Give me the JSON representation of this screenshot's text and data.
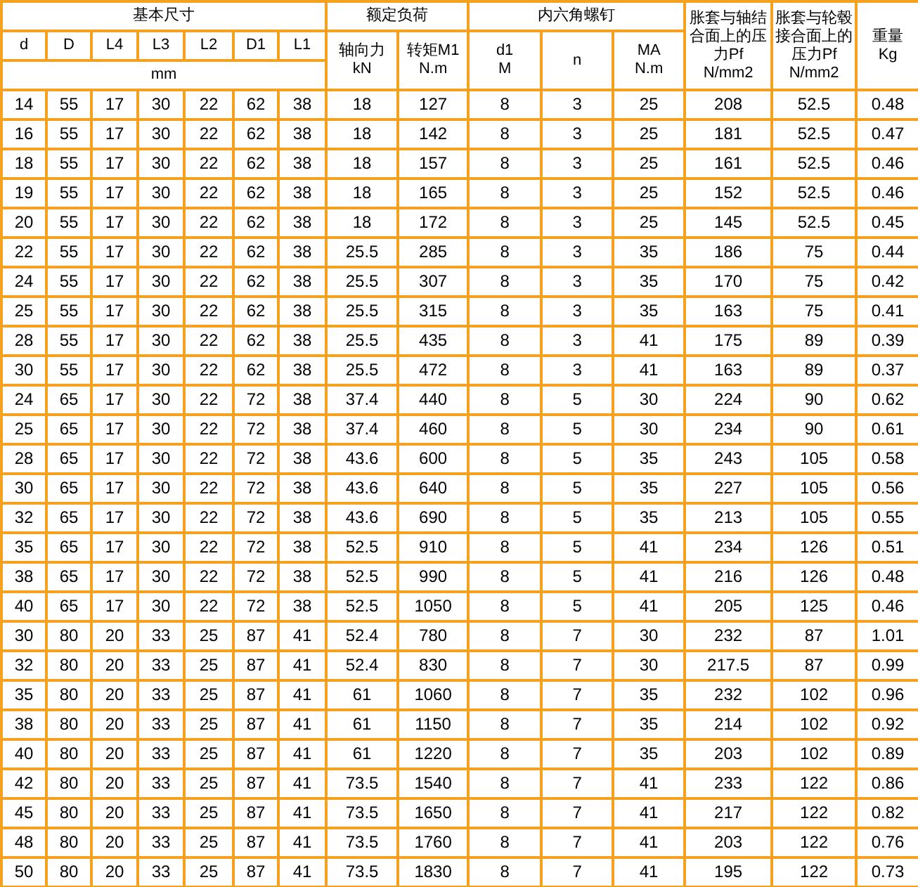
{
  "table": {
    "header_rows": [
      [
        {
          "lines": [
            "基本尺寸"
          ],
          "colspan": 7
        },
        {
          "lines": [
            "额定负荷"
          ],
          "colspan": 2
        },
        {
          "lines": [
            "内六角螺钉"
          ],
          "colspan": 3
        },
        {
          "lines": [
            "胀套与轴结",
            "合面上的压",
            "力Pf",
            "N/mm2"
          ],
          "rowspan": 3
        },
        {
          "lines": [
            "胀套与轮毂",
            "接合面上的",
            "压力Pf",
            "N/mm2"
          ],
          "rowspan": 3
        },
        {
          "lines": [
            "重量",
            "Kg"
          ],
          "rowspan": 3
        }
      ],
      [
        {
          "lines": [
            "d"
          ]
        },
        {
          "lines": [
            "D"
          ]
        },
        {
          "lines": [
            "L4"
          ]
        },
        {
          "lines": [
            "L3"
          ]
        },
        {
          "lines": [
            "L2"
          ]
        },
        {
          "lines": [
            "D1"
          ]
        },
        {
          "lines": [
            "L1"
          ]
        },
        {
          "lines": [
            "轴向力",
            "kN"
          ],
          "rowspan": 2
        },
        {
          "lines": [
            "转矩M1",
            "N.m"
          ],
          "rowspan": 2
        },
        {
          "lines": [
            "d1",
            "M"
          ],
          "rowspan": 2
        },
        {
          "lines": [
            "n"
          ],
          "rowspan": 2
        },
        {
          "lines": [
            "MA",
            "N.m"
          ],
          "rowspan": 2
        }
      ],
      [
        {
          "lines": [
            "mm"
          ],
          "colspan": 7
        }
      ]
    ],
    "rows": [
      [
        "14",
        "55",
        "17",
        "30",
        "22",
        "62",
        "38",
        "18",
        "127",
        "8",
        "3",
        "25",
        "208",
        "52.5",
        "0.48"
      ],
      [
        "16",
        "55",
        "17",
        "30",
        "22",
        "62",
        "38",
        "18",
        "142",
        "8",
        "3",
        "25",
        "181",
        "52.5",
        "0.47"
      ],
      [
        "18",
        "55",
        "17",
        "30",
        "22",
        "62",
        "38",
        "18",
        "157",
        "8",
        "3",
        "25",
        "161",
        "52.5",
        "0.46"
      ],
      [
        "19",
        "55",
        "17",
        "30",
        "22",
        "62",
        "38",
        "18",
        "165",
        "8",
        "3",
        "25",
        "152",
        "52.5",
        "0.46"
      ],
      [
        "20",
        "55",
        "17",
        "30",
        "22",
        "62",
        "38",
        "18",
        "172",
        "8",
        "3",
        "25",
        "145",
        "52.5",
        "0.45"
      ],
      [
        "22",
        "55",
        "17",
        "30",
        "22",
        "62",
        "38",
        "25.5",
        "285",
        "8",
        "3",
        "35",
        "186",
        "75",
        "0.44"
      ],
      [
        "24",
        "55",
        "17",
        "30",
        "22",
        "62",
        "38",
        "25.5",
        "307",
        "8",
        "3",
        "35",
        "170",
        "75",
        "0.42"
      ],
      [
        "25",
        "55",
        "17",
        "30",
        "22",
        "62",
        "38",
        "25.5",
        "315",
        "8",
        "3",
        "35",
        "163",
        "75",
        "0.41"
      ],
      [
        "28",
        "55",
        "17",
        "30",
        "22",
        "62",
        "38",
        "25.5",
        "435",
        "8",
        "3",
        "41",
        "175",
        "89",
        "0.39"
      ],
      [
        "30",
        "55",
        "17",
        "30",
        "22",
        "62",
        "38",
        "25.5",
        "472",
        "8",
        "3",
        "41",
        "163",
        "89",
        "0.37"
      ],
      [
        "24",
        "65",
        "17",
        "30",
        "22",
        "72",
        "38",
        "37.4",
        "440",
        "8",
        "5",
        "30",
        "224",
        "90",
        "0.62"
      ],
      [
        "25",
        "65",
        "17",
        "30",
        "22",
        "72",
        "38",
        "37.4",
        "460",
        "8",
        "5",
        "30",
        "234",
        "90",
        "0.61"
      ],
      [
        "28",
        "65",
        "17",
        "30",
        "22",
        "72",
        "38",
        "43.6",
        "600",
        "8",
        "5",
        "35",
        "243",
        "105",
        "0.58"
      ],
      [
        "30",
        "65",
        "17",
        "30",
        "22",
        "72",
        "38",
        "43.6",
        "640",
        "8",
        "5",
        "35",
        "227",
        "105",
        "0.56"
      ],
      [
        "32",
        "65",
        "17",
        "30",
        "22",
        "72",
        "38",
        "43.6",
        "690",
        "8",
        "5",
        "35",
        "213",
        "105",
        "0.55"
      ],
      [
        "35",
        "65",
        "17",
        "30",
        "22",
        "72",
        "38",
        "52.5",
        "910",
        "8",
        "5",
        "41",
        "234",
        "126",
        "0.51"
      ],
      [
        "38",
        "65",
        "17",
        "30",
        "22",
        "72",
        "38",
        "52.5",
        "990",
        "8",
        "5",
        "41",
        "216",
        "126",
        "0.48"
      ],
      [
        "40",
        "65",
        "17",
        "30",
        "22",
        "72",
        "38",
        "52.5",
        "1050",
        "8",
        "5",
        "41",
        "205",
        "125",
        "0.46"
      ],
      [
        "30",
        "80",
        "20",
        "33",
        "25",
        "87",
        "41",
        "52.4",
        "780",
        "8",
        "7",
        "30",
        "232",
        "87",
        "1.01"
      ],
      [
        "32",
        "80",
        "20",
        "33",
        "25",
        "87",
        "41",
        "52.4",
        "830",
        "8",
        "7",
        "30",
        "217.5",
        "87",
        "0.99"
      ],
      [
        "35",
        "80",
        "20",
        "33",
        "25",
        "87",
        "41",
        "61",
        "1060",
        "8",
        "7",
        "35",
        "232",
        "102",
        "0.96"
      ],
      [
        "38",
        "80",
        "20",
        "33",
        "25",
        "87",
        "41",
        "61",
        "1150",
        "8",
        "7",
        "35",
        "214",
        "102",
        "0.92"
      ],
      [
        "40",
        "80",
        "20",
        "33",
        "25",
        "87",
        "41",
        "61",
        "1220",
        "8",
        "7",
        "35",
        "203",
        "102",
        "0.89"
      ],
      [
        "42",
        "80",
        "20",
        "33",
        "25",
        "87",
        "41",
        "73.5",
        "1540",
        "8",
        "7",
        "41",
        "233",
        "122",
        "0.86"
      ],
      [
        "45",
        "80",
        "20",
        "33",
        "25",
        "87",
        "41",
        "73.5",
        "1650",
        "8",
        "7",
        "41",
        "217",
        "122",
        "0.82"
      ],
      [
        "48",
        "80",
        "20",
        "33",
        "25",
        "87",
        "41",
        "73.5",
        "1760",
        "8",
        "7",
        "41",
        "203",
        "122",
        "0.76"
      ],
      [
        "50",
        "80",
        "20",
        "33",
        "25",
        "87",
        "41",
        "73.5",
        "1830",
        "8",
        "7",
        "41",
        "195",
        "122",
        "0.73"
      ]
    ]
  }
}
